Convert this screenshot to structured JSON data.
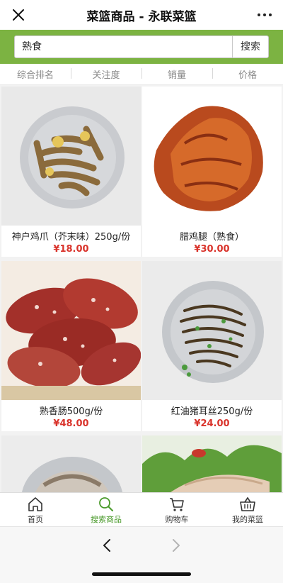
{
  "titlebar": {
    "title": "菜篮商品 - 永联菜篮"
  },
  "search": {
    "value": "熟食",
    "button_label": "搜索"
  },
  "sort_tabs": [
    "综合排名",
    "关注度",
    "销量",
    "价格"
  ],
  "products": [
    {
      "name": "神户鸡爪（芥末味）250g/份",
      "price": "¥18.00"
    },
    {
      "name": "腊鸡腿（熟食）",
      "price": "¥30.00"
    },
    {
      "name": "熟香肠500g/份",
      "price": "¥48.00"
    },
    {
      "name": "红油猪耳丝250g/份",
      "price": "¥24.00"
    }
  ],
  "bottom_nav": [
    {
      "label": "首页",
      "icon": "home-icon"
    },
    {
      "label": "搜索商品",
      "icon": "search-icon",
      "active": true
    },
    {
      "label": "购物车",
      "icon": "cart-icon"
    },
    {
      "label": "我的菜篮",
      "icon": "basket-icon"
    }
  ],
  "colors": {
    "brand_green": "#7cb342",
    "price_red": "#d9332b",
    "active_nav": "#4a9a2b"
  }
}
